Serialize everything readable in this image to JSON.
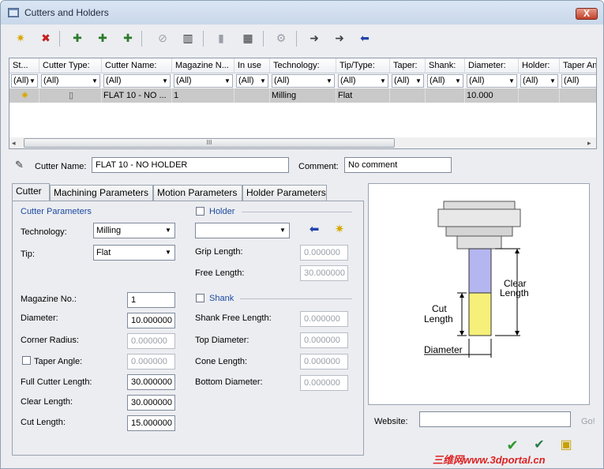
{
  "window": {
    "title": "Cutters and Holders",
    "close_label": "X"
  },
  "grid": {
    "columns": [
      "St...",
      "Cutter Type:",
      "Cutter Name:",
      "Magazine N...",
      "In use",
      "Technology:",
      "Tip/Type:",
      "Taper:",
      "Shank:",
      "Diameter:",
      "Holder:",
      "Taper An"
    ],
    "filter_value": "(All)",
    "row": {
      "name": "FLAT 10 - NO ...",
      "magazine": "1",
      "technology": "Milling",
      "tip": "Flat",
      "diameter": "10.000"
    }
  },
  "scroll_thumb": "III",
  "cutter_name_label": "Cutter Name:",
  "cutter_name_value": "FLAT 10 - NO HOLDER",
  "comment_label": "Comment:",
  "comment_value": "No comment",
  "tabs": [
    "Cutter",
    "Machining Parameters",
    "Motion Parameters",
    "Holder Parameters"
  ],
  "cutter_params": {
    "section": "Cutter Parameters",
    "technology_label": "Technology:",
    "technology_value": "Milling",
    "tip_label": "Tip:",
    "tip_value": "Flat",
    "magazine_label": "Magazine No.:",
    "magazine_value": "1",
    "diameter_label": "Diameter:",
    "diameter_value": "10.000000",
    "corner_label": "Corner Radius:",
    "corner_value": "0.000000",
    "taper_label": "Taper Angle:",
    "taper_value": "0.000000",
    "full_label": "Full Cutter Length:",
    "full_value": "30.000000",
    "clear_label": "Clear Length:",
    "clear_value": "30.000000",
    "cut_label": "Cut Length:",
    "cut_value": "15.000000"
  },
  "holder": {
    "section": "Holder",
    "grip_label": "Grip Length:",
    "grip_value": "0.000000",
    "free_label": "Free Length:",
    "free_value": "30.000000"
  },
  "shank": {
    "section": "Shank",
    "free_label": "Shank Free Length:",
    "free_value": "0.000000",
    "top_label": "Top Diameter:",
    "top_value": "0.000000",
    "cone_label": "Cone Length:",
    "cone_value": "0.000000",
    "bottom_label": "Bottom Diameter:",
    "bottom_value": "0.000000"
  },
  "diagram": {
    "clear_label_1": "Clear",
    "clear_label_2": "Length",
    "cut_label_1": "Cut",
    "cut_label_2": "Length",
    "diameter_label": "Diameter"
  },
  "website_label": "Website:",
  "website_value": "",
  "go_label": "Go!",
  "watermark": "三维网www.3dportal.cn"
}
